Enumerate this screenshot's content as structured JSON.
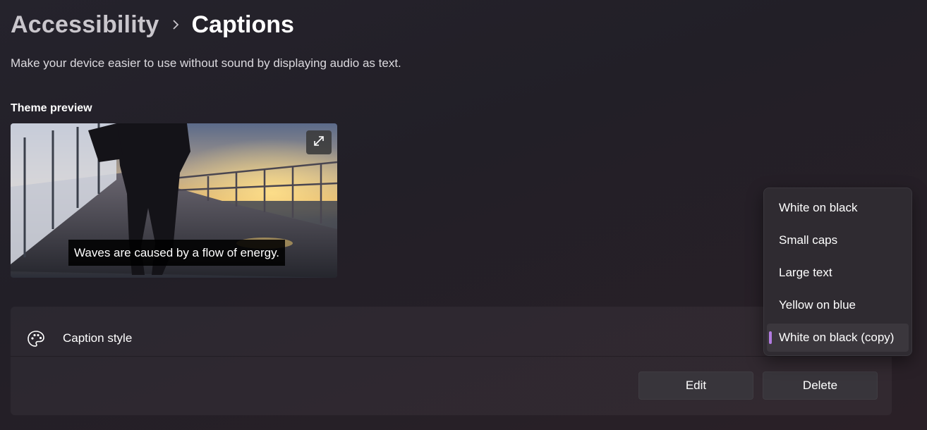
{
  "breadcrumb": {
    "parent": "Accessibility",
    "current": "Captions"
  },
  "description": "Make your device easier to use without sound by displaying audio as text.",
  "theme_preview": {
    "label": "Theme preview",
    "caption_text": "Waves are caused by a flow of energy.",
    "expand_icon": "expand-icon"
  },
  "caption_style": {
    "label": "Caption style",
    "icon": "palette-icon",
    "edit_label": "Edit",
    "delete_label": "Delete"
  },
  "dropdown": {
    "options": [
      "White on black",
      "Small caps",
      "Large text",
      "Yellow on blue",
      "White on black (copy)"
    ],
    "selected": "White on black (copy)",
    "accent_color": "#b27be0"
  }
}
